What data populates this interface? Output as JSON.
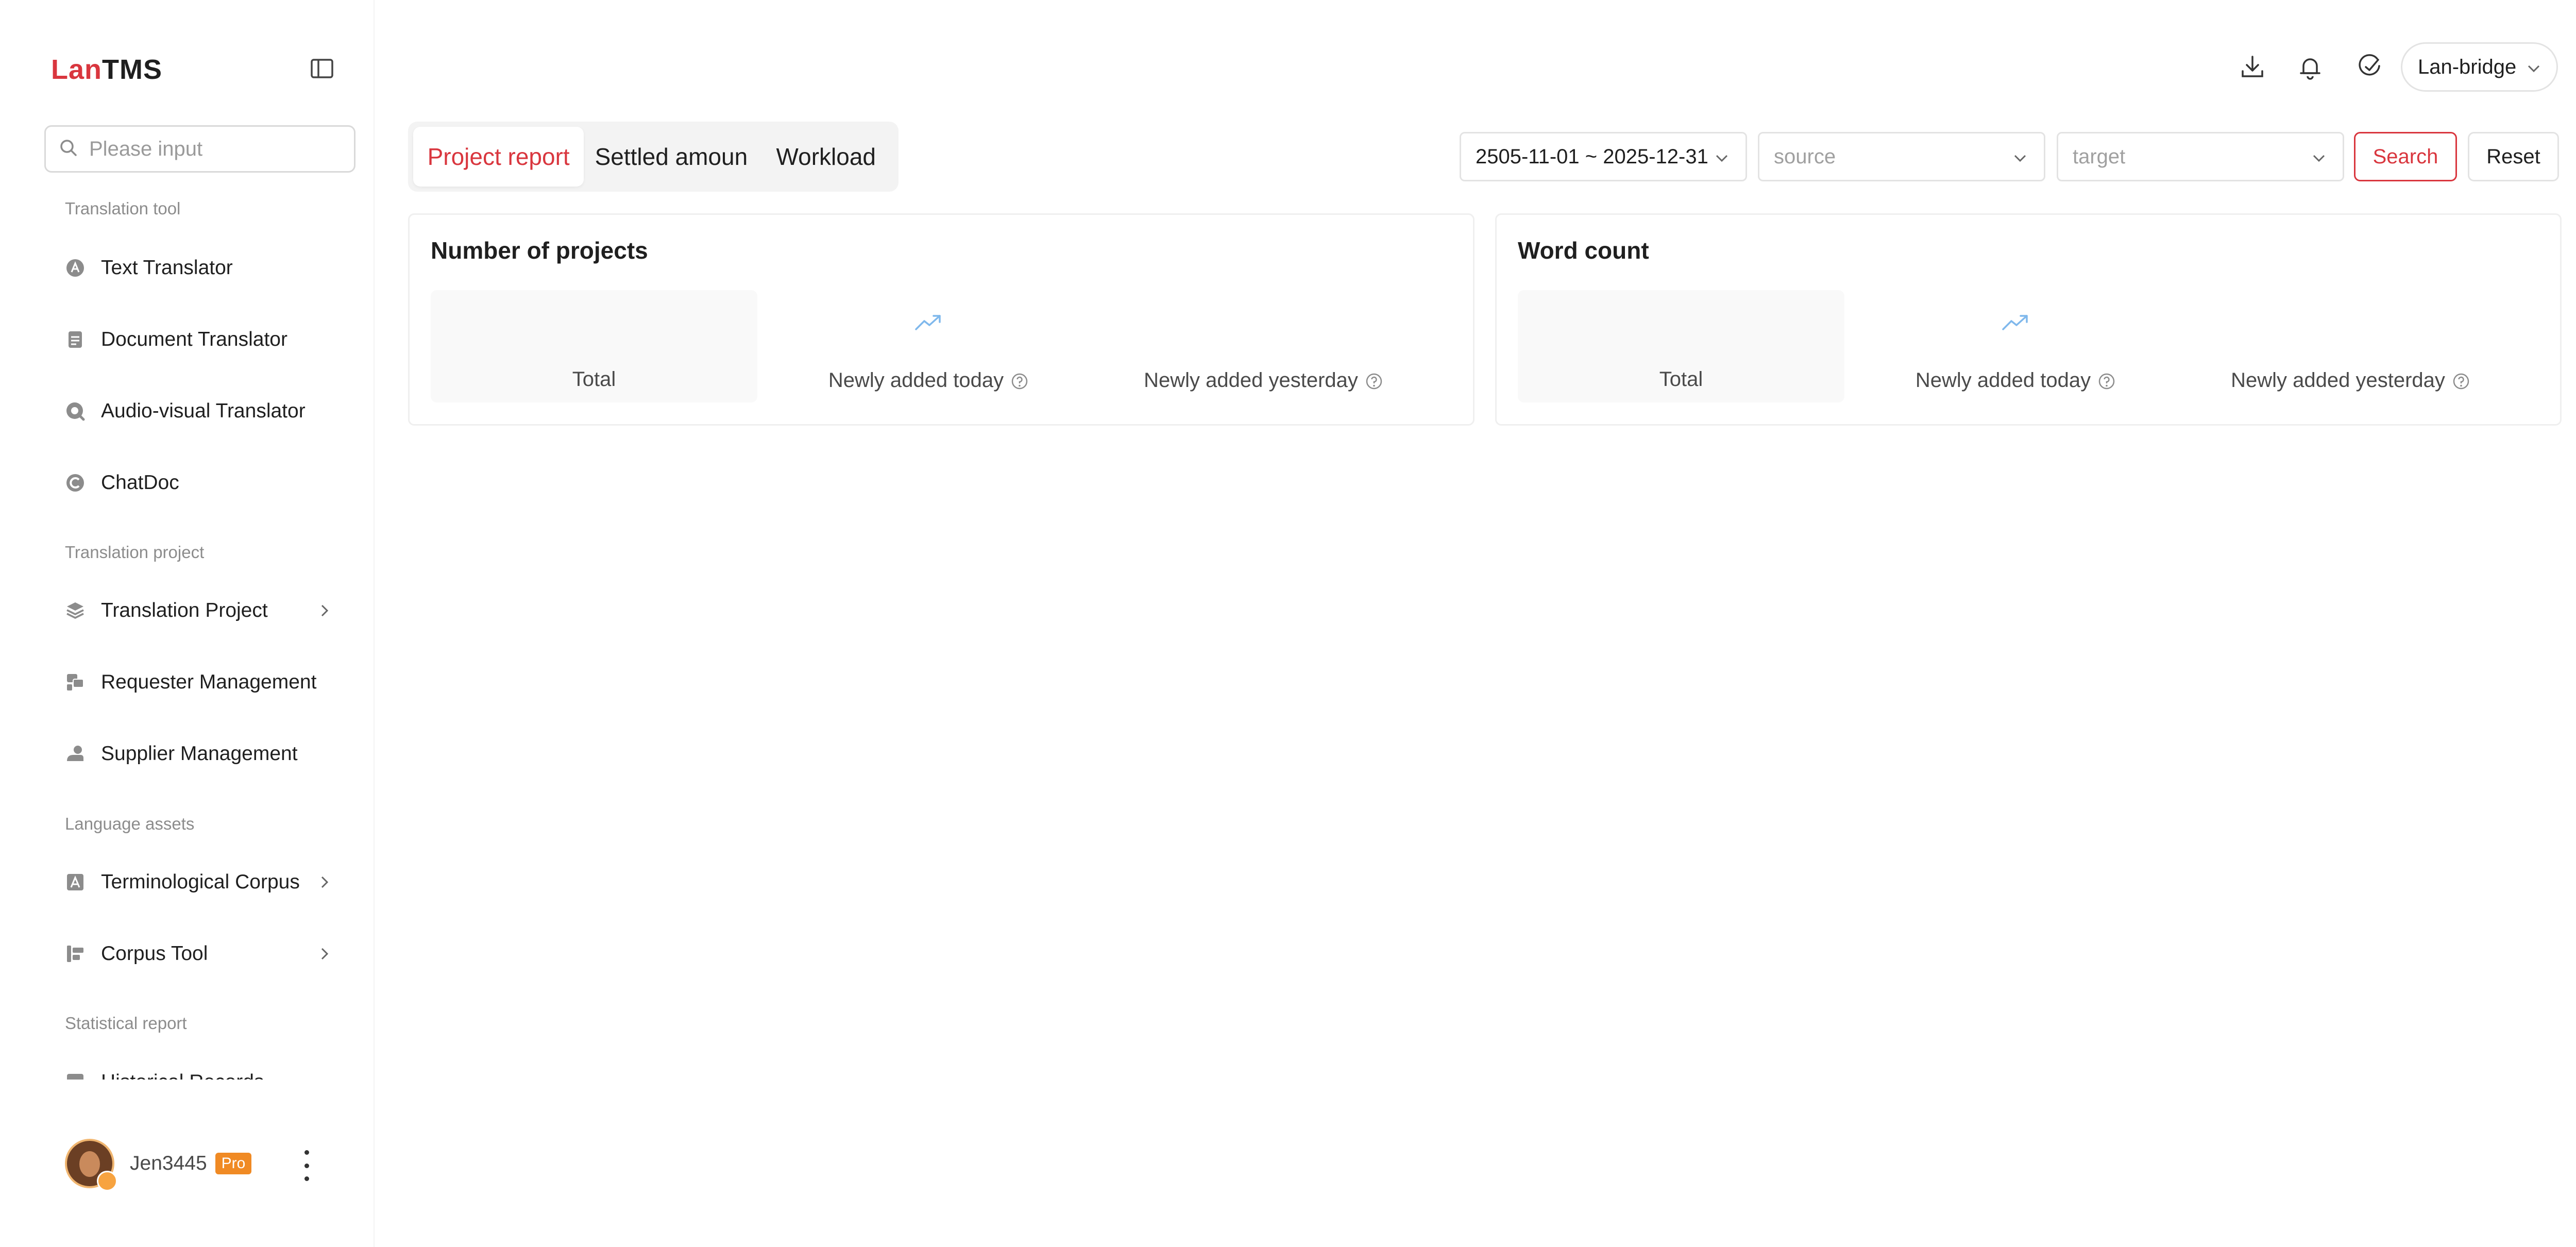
{
  "logo": {
    "part1": "Lan",
    "part2": "TMS"
  },
  "search": {
    "placeholder": "Please input"
  },
  "sidebar": {
    "sections": [
      {
        "label": "Translation tool"
      },
      {
        "label": "Translation project"
      },
      {
        "label": "Language assets"
      },
      {
        "label": "Statistical report"
      }
    ],
    "items": [
      {
        "label": "Text Translator",
        "icon": "text-translator-icon"
      },
      {
        "label": "Document Translator",
        "icon": "document-icon"
      },
      {
        "label": "Audio-visual Translator",
        "icon": "audio-visual-icon"
      },
      {
        "label": "ChatDoc",
        "icon": "chatdoc-icon"
      },
      {
        "label": "Translation Project",
        "icon": "layers-icon",
        "has_submenu": true
      },
      {
        "label": "Requester Management",
        "icon": "requester-icon"
      },
      {
        "label": "Supplier Management",
        "icon": "supplier-icon"
      },
      {
        "label": "Terminological Corpus",
        "icon": "terminology-icon",
        "has_submenu": true
      },
      {
        "label": "Corpus Tool",
        "icon": "corpus-tool-icon",
        "has_submenu": true
      },
      {
        "label": "Historical Records",
        "icon": "history-icon"
      }
    ]
  },
  "user": {
    "name": "Jen3445",
    "badge": "Pro"
  },
  "header": {
    "org": "Lan-bridge",
    "icons": [
      "download-icon",
      "bell-icon",
      "feedback-icon"
    ]
  },
  "tabs": [
    {
      "label": "Project report",
      "active": true
    },
    {
      "label": "Settled amoun",
      "active": false
    },
    {
      "label": "Workload",
      "active": false
    }
  ],
  "filters": {
    "date_range": "2505-11-01 ~ 2025-12-31",
    "source_placeholder": "source",
    "target_placeholder": "target",
    "search_label": "Search",
    "reset_label": "Reset"
  },
  "cards": [
    {
      "title": "Number of projects",
      "total_label": "Total",
      "today_label": "Newly added today",
      "yesterday_label": "Newly added yesterday"
    },
    {
      "title": "Word count",
      "total_label": "Total",
      "today_label": "Newly added today",
      "yesterday_label": "Newly added yesterday"
    }
  ],
  "colors": {
    "accent": "#d9363e",
    "pro_badge": "#f08a24",
    "trend_icon": "#7fb8ec",
    "muted_text": "#8c8c8c"
  }
}
